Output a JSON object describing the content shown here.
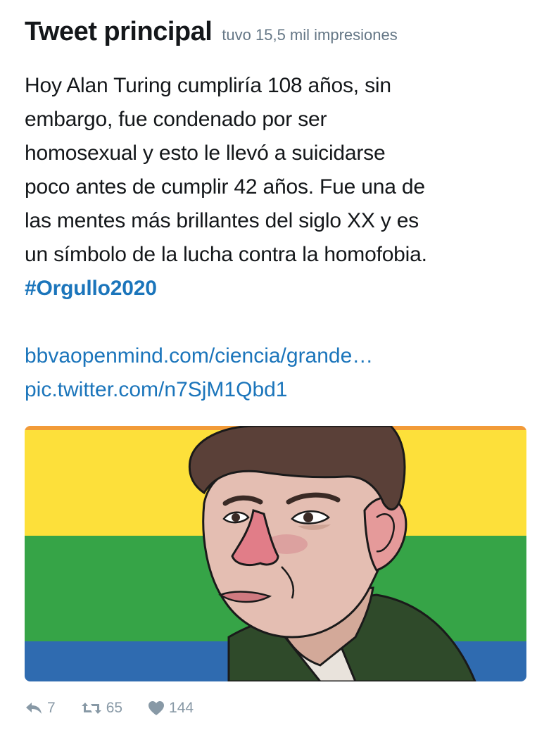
{
  "header": {
    "title": "Tweet principal",
    "impressions": "tuvo 15,5 mil impresiones"
  },
  "tweet": {
    "lines": [
      "Hoy Alan Turing cumpliría 108 años, sin",
      "embargo, fue condenado por ser",
      "homosexual y esto le llevó a suicidarse",
      "poco antes de cumplir 42 años. Fue una de",
      "las mentes más brillantes del siglo XX y es",
      "un símbolo de la lucha contra la homofobia."
    ],
    "hashtag": "#Orgullo2020",
    "link": "bbvaopenmind.com/ciencia/grande…",
    "pic_link": "pic.twitter.com/n7SjM1Qbd1"
  },
  "media": {
    "description_icon": "alan-turing-illustration",
    "flag_colors": [
      "#f29b38",
      "#fde03a",
      "#36a447",
      "#2f6bb0"
    ]
  },
  "actions": {
    "replies": "7",
    "retweets": "65",
    "likes": "144"
  },
  "colors": {
    "link": "#1b75bb",
    "muted": "#8899a6",
    "text": "#14171a"
  }
}
